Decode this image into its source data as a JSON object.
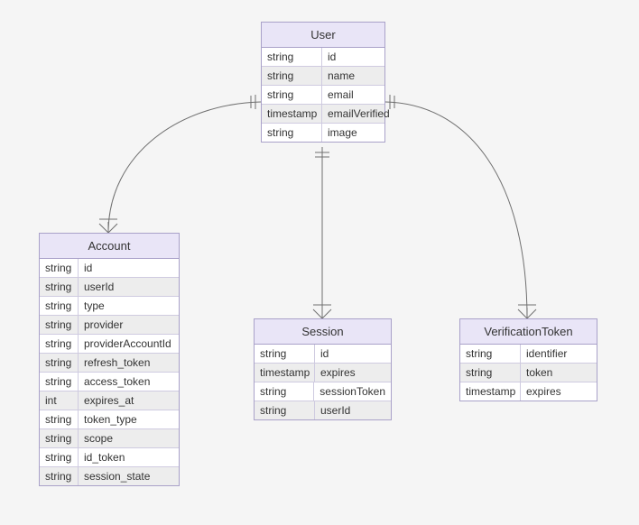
{
  "diagram_type": "entity-relationship",
  "entities": {
    "user": {
      "title": "User",
      "rows": [
        {
          "type": "string",
          "name": "id",
          "alt": false
        },
        {
          "type": "string",
          "name": "name",
          "alt": true
        },
        {
          "type": "string",
          "name": "email",
          "alt": false
        },
        {
          "type": "timestamp",
          "name": "emailVerified",
          "alt": true
        },
        {
          "type": "string",
          "name": "image",
          "alt": false
        }
      ]
    },
    "account": {
      "title": "Account",
      "rows": [
        {
          "type": "string",
          "name": "id",
          "alt": false
        },
        {
          "type": "string",
          "name": "userId",
          "alt": true
        },
        {
          "type": "string",
          "name": "type",
          "alt": false
        },
        {
          "type": "string",
          "name": "provider",
          "alt": true
        },
        {
          "type": "string",
          "name": "providerAccountId",
          "alt": false
        },
        {
          "type": "string",
          "name": "refresh_token",
          "alt": true
        },
        {
          "type": "string",
          "name": "access_token",
          "alt": false
        },
        {
          "type": "int",
          "name": "expires_at",
          "alt": true
        },
        {
          "type": "string",
          "name": "token_type",
          "alt": false
        },
        {
          "type": "string",
          "name": "scope",
          "alt": true
        },
        {
          "type": "string",
          "name": "id_token",
          "alt": false
        },
        {
          "type": "string",
          "name": "session_state",
          "alt": true
        }
      ]
    },
    "session": {
      "title": "Session",
      "rows": [
        {
          "type": "string",
          "name": "id",
          "alt": false
        },
        {
          "type": "timestamp",
          "name": "expires",
          "alt": true
        },
        {
          "type": "string",
          "name": "sessionToken",
          "alt": false
        },
        {
          "type": "string",
          "name": "userId",
          "alt": true
        }
      ]
    },
    "verificationtoken": {
      "title": "VerificationToken",
      "rows": [
        {
          "type": "string",
          "name": "identifier",
          "alt": false
        },
        {
          "type": "string",
          "name": "token",
          "alt": true
        },
        {
          "type": "timestamp",
          "name": "expires",
          "alt": false
        }
      ]
    }
  },
  "relationships": [
    {
      "from": "user",
      "to": "account",
      "type": "one-to-many"
    },
    {
      "from": "user",
      "to": "session",
      "type": "one-to-many"
    },
    {
      "from": "user",
      "to": "verificationtoken",
      "type": "one-to-many"
    }
  ]
}
